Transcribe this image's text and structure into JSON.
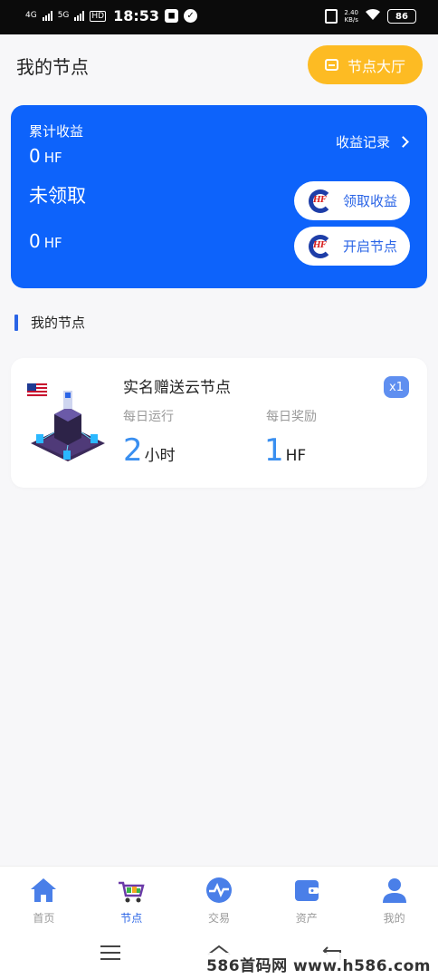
{
  "status_bar": {
    "signal1": "4G",
    "signal2": "5G",
    "hd": "HD",
    "time": "18:53",
    "net_speed_value": "2.40",
    "net_speed_unit": "KB/s",
    "battery": "86"
  },
  "header": {
    "title": "我的节点",
    "hall_button": "节点大厅"
  },
  "earnings_card": {
    "total_label": "累计收益",
    "total_value": "0",
    "total_unit": "HF",
    "records_link": "收益记录",
    "unclaimed_label": "未领取",
    "unclaimed_value": "0",
    "unclaimed_unit": "HF",
    "claim_button": "领取收益",
    "start_button": "开启节点",
    "logo_text": "HF"
  },
  "section": {
    "title": "我的节点"
  },
  "node": {
    "name": "实名赠送云节点",
    "count_badge": "x1",
    "daily_run_label": "每日运行",
    "daily_run_value": "2",
    "daily_run_unit": "小时",
    "daily_reward_label": "每日奖励",
    "daily_reward_value": "1",
    "daily_reward_unit": "HF"
  },
  "tabbar": {
    "items": [
      {
        "label": "首页",
        "icon": "home-icon",
        "active": false
      },
      {
        "label": "节点",
        "icon": "cart-icon",
        "active": true
      },
      {
        "label": "交易",
        "icon": "exchange-icon",
        "active": false
      },
      {
        "label": "资产",
        "icon": "wallet-icon",
        "active": false
      },
      {
        "label": "我的",
        "icon": "user-icon",
        "active": false
      }
    ]
  },
  "watermark": "586首码网 www.h586.com",
  "colors": {
    "primary_blue": "#0d63fb",
    "accent_yellow": "#fdbb23",
    "value_blue": "#3a8ff0",
    "tab_active": "#2a64e6"
  }
}
